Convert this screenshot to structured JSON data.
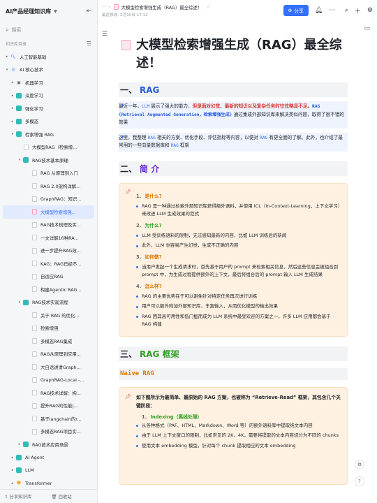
{
  "sidebar": {
    "title": "AI产品经理知识库",
    "search_placeholder": "搜索",
    "section_label": "知识库目录",
    "items": [
      {
        "label": "人工智能基础",
        "depth": 0,
        "icon": "search",
        "twisty": "▸"
      },
      {
        "label": "AI 核心技术",
        "depth": 0,
        "icon": "globe",
        "twisty": "▾"
      },
      {
        "label": "机器学习",
        "depth": 1,
        "icon": "robot",
        "twisty": "▸"
      },
      {
        "label": "深度学习",
        "depth": 1,
        "icon": "wiki",
        "twisty": "▸"
      },
      {
        "label": "强化学习",
        "depth": 1,
        "icon": "wiki",
        "twisty": "▸"
      },
      {
        "label": "多模态",
        "depth": 1,
        "icon": "wiki",
        "twisty": "▸"
      },
      {
        "label": "检索增强 RAG",
        "depth": 1,
        "icon": "wiki",
        "twisty": "▾"
      },
      {
        "label": "大模型RAG（检索增...",
        "depth": 2,
        "icon": "doc",
        "twisty": ""
      },
      {
        "label": "RAG技术基本原理",
        "depth": 2,
        "icon": "wiki",
        "twisty": "▾"
      },
      {
        "label": "RAG 从原理到入门",
        "depth": 3,
        "icon": "doc",
        "twisty": ""
      },
      {
        "label": "RAG 2.0架构详解...",
        "depth": 3,
        "icon": "doc",
        "twisty": ""
      },
      {
        "label": "GraphRAG：知识...",
        "depth": 3,
        "icon": "doc",
        "twisty": ""
      },
      {
        "label": "大模型检索增强...",
        "depth": 3,
        "icon": "docpink",
        "twisty": "",
        "active": true
      },
      {
        "label": "RAG技术梳理及实...",
        "depth": 3,
        "icon": "doc",
        "twisty": ""
      },
      {
        "label": "一文详解16种RA...",
        "depth": 3,
        "icon": "doc",
        "twisty": ""
      },
      {
        "label": "进一步提升RAG效...",
        "depth": 3,
        "icon": "doc",
        "twisty": ""
      },
      {
        "label": "KAG：RAG已经不...",
        "depth": 3,
        "icon": "doc",
        "twisty": ""
      },
      {
        "label": "自适应RAG",
        "depth": 3,
        "icon": "doc",
        "twisty": ""
      },
      {
        "label": "构建Agentic RAG...",
        "depth": 3,
        "icon": "doc",
        "twisty": ""
      },
      {
        "label": "RAG技术实现流程",
        "depth": 2,
        "icon": "wiki",
        "twisty": "▾"
      },
      {
        "label": "关于 RAG 的优化...",
        "depth": 3,
        "icon": "doc",
        "twisty": ""
      },
      {
        "label": "检索增强",
        "depth": 3,
        "icon": "doc",
        "twisty": ""
      },
      {
        "label": "多模态RAG集成",
        "depth": 3,
        "icon": "doc",
        "twisty": ""
      },
      {
        "label": "RAG从原理到应用...",
        "depth": 3,
        "icon": "doc",
        "twisty": ""
      },
      {
        "label": "大白话讲清Graph...",
        "depth": 3,
        "icon": "doc",
        "twisty": ""
      },
      {
        "label": "GraphRAG-Local -...",
        "depth": 3,
        "icon": "doc",
        "twisty": ""
      },
      {
        "label": "RAG技术详解：构...",
        "depth": 3,
        "icon": "doc",
        "twisty": ""
      },
      {
        "label": "提升RAG的性能|...",
        "depth": 3,
        "icon": "doc",
        "twisty": ""
      },
      {
        "label": "基于langchain的r...",
        "depth": 3,
        "icon": "doc",
        "twisty": ""
      },
      {
        "label": "多模态RAG项目实...",
        "depth": 3,
        "icon": "doc",
        "twisty": ""
      },
      {
        "label": "RAG技术应用场景",
        "depth": 2,
        "icon": "wiki",
        "twisty": "▸"
      },
      {
        "label": "AI Agent",
        "depth": 1,
        "icon": "wiki",
        "twisty": "▸"
      },
      {
        "label": "LLM",
        "depth": 1,
        "icon": "wiki",
        "twisty": "▸"
      },
      {
        "label": "Transformer",
        "depth": 1,
        "icon": "hf",
        "twisty": "▸"
      }
    ],
    "footer_share": "分享知识库",
    "footer_trash": "回收站"
  },
  "header": {
    "breadcrumb_dots": "···",
    "breadcrumb_title": "大模型检索增强生成（RAG）最全综述！",
    "last_modified": "最近修改: 2月10日 17:12",
    "share_label": "分享"
  },
  "document": {
    "title": "大模型检索增强生成（RAG）最全综述！",
    "s1_num": "一、",
    "s1_title": "RAG",
    "p1_a": "最近一年，",
    "p1_b": "LLM",
    "p1_c": " 展示了强大的能力，",
    "p1_d": "但是面对幻觉、最新的知识以及复杂任务时往往略显不足。",
    "p1_e": "RAG (Retrieval Augmented Generation，检索增强生成)",
    "p1_f": " 通过集成外部知识库来解决类似问题，取得了很不错的效果",
    "p2_a": "这里，我整理 ",
    "p2_b": "RAG",
    "p2_c": " 相关的方案、优化手段、评估指标等内容，以便对 ",
    "p2_d": "RAG",
    "p2_e": " 有更全面的了解。此外，也介绍了最常用的一些向量数据库和 ",
    "p2_f": "RAG",
    "p2_g": " 框架",
    "s2_num": "二、",
    "s2_title": "简 介",
    "q1": "是什么?",
    "q1_b1": "RAG 是一种通过检索外部知识库获得额外语料，并使用 ICL（In-Context-Learning，上下文学习）来改进 LLM 生成效果的范式",
    "q2": "为什么?",
    "q2_b1": "LLM 受训练语料的限制，无法感知最新的内容，比如 LLM 训练后的新闻",
    "q2_b2": "此外，LLM 也容易产生幻觉，生成不正确的内容",
    "q3": "如何做?",
    "q3_b1": "当用户发起一个生成请求时，首先基于用户的 prompt 来检索相关信息，然后这些信息会被组合到 prompt 中，为生成过程提供额外的上下文，最后将组合后的 prompt 输入 LLM 生成结果",
    "q4": "怎么样?",
    "q4_b1": "RAG 的主要优势在于可以避免针对特定任务再次进行训练",
    "q4_b2": "用户可以额外附加外部知识库，丰富输入，从而优化模型的输出效果",
    "q4_b3": "RAG 因其高可用性和低门槛而成为 LLM 系统中最受欢迎的方案之一，许多 LLM 应用都会基于 RAG 构建",
    "s3_num": "三、",
    "s3_title": "RAG 框架",
    "h3": "Naive RAG",
    "c2_text": "如下图所示为最简单、最原始的 RAG 方案，也被称为 “Retrieve-Read” 框架，其包含几个关键阶段：",
    "idx_title": "Indexing（离线处理）",
    "idx_b1": "从各种格式（PAF、HTML、Markdown、Word 等）的额外语料库中提取纯文本内容",
    "idx_b2": "由于 LLM 上下文窗口的限制，比如常见的 2K、4K，需要将提取的文本内容切分为不同的 chunks",
    "idx_b3": "使用文本 embedding 模型，针对每个 chunk 提取相应的文本 embedding"
  },
  "colors": {
    "accent": "#3370ff",
    "sidebar_bg": "#f5f6f7",
    "callout_bg": "#fef1e1"
  }
}
